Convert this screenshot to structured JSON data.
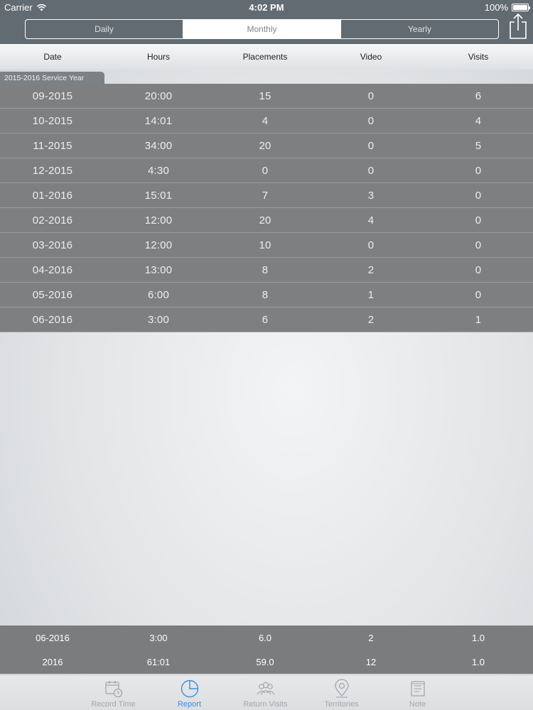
{
  "status": {
    "carrier": "Carrier",
    "time": "4:02 PM",
    "battery": "100%",
    "battery_level": 1.0
  },
  "segments": [
    {
      "label": "Daily",
      "active": false
    },
    {
      "label": "Monthly",
      "active": true
    },
    {
      "label": "Yearly",
      "active": false
    }
  ],
  "columns": [
    "Date",
    "Hours",
    "Placements",
    "Video",
    "Visits"
  ],
  "section": {
    "label": "2015-2016 Service Year"
  },
  "rows": [
    [
      "09-2015",
      "20:00",
      "15",
      "0",
      "6"
    ],
    [
      "10-2015",
      "14:01",
      "4",
      "0",
      "4"
    ],
    [
      "11-2015",
      "34:00",
      "20",
      "0",
      "5"
    ],
    [
      "12-2015",
      "4:30",
      "0",
      "0",
      "0"
    ],
    [
      "01-2016",
      "15:01",
      "7",
      "3",
      "0"
    ],
    [
      "02-2016",
      "12:00",
      "20",
      "4",
      "0"
    ],
    [
      "03-2016",
      "12:00",
      "10",
      "0",
      "0"
    ],
    [
      "04-2016",
      "13:00",
      "8",
      "2",
      "0"
    ],
    [
      "05-2016",
      "6:00",
      "8",
      "1",
      "0"
    ],
    [
      "06-2016",
      "3:00",
      "6",
      "2",
      "1"
    ]
  ],
  "summary": [
    [
      "06-2016",
      "3:00",
      "6.0",
      "2",
      "1.0"
    ],
    [
      "2016",
      "61:01",
      "59.0",
      "12",
      "1.0"
    ]
  ],
  "tabs": [
    {
      "label": "Record Time",
      "icon": "calendar-clock-icon",
      "active": false
    },
    {
      "label": "Report",
      "icon": "pie-chart-icon",
      "active": true
    },
    {
      "label": "Return Visits",
      "icon": "people-icon",
      "active": false
    },
    {
      "label": "Territories",
      "icon": "map-pin-icon",
      "active": false
    },
    {
      "label": "Note",
      "icon": "notepad-icon",
      "active": false
    }
  ],
  "colors": {
    "header": "#636b72",
    "row": "#7e7f81",
    "accent": "#3d8fe0",
    "tab_inactive": "#a3a7ab"
  }
}
